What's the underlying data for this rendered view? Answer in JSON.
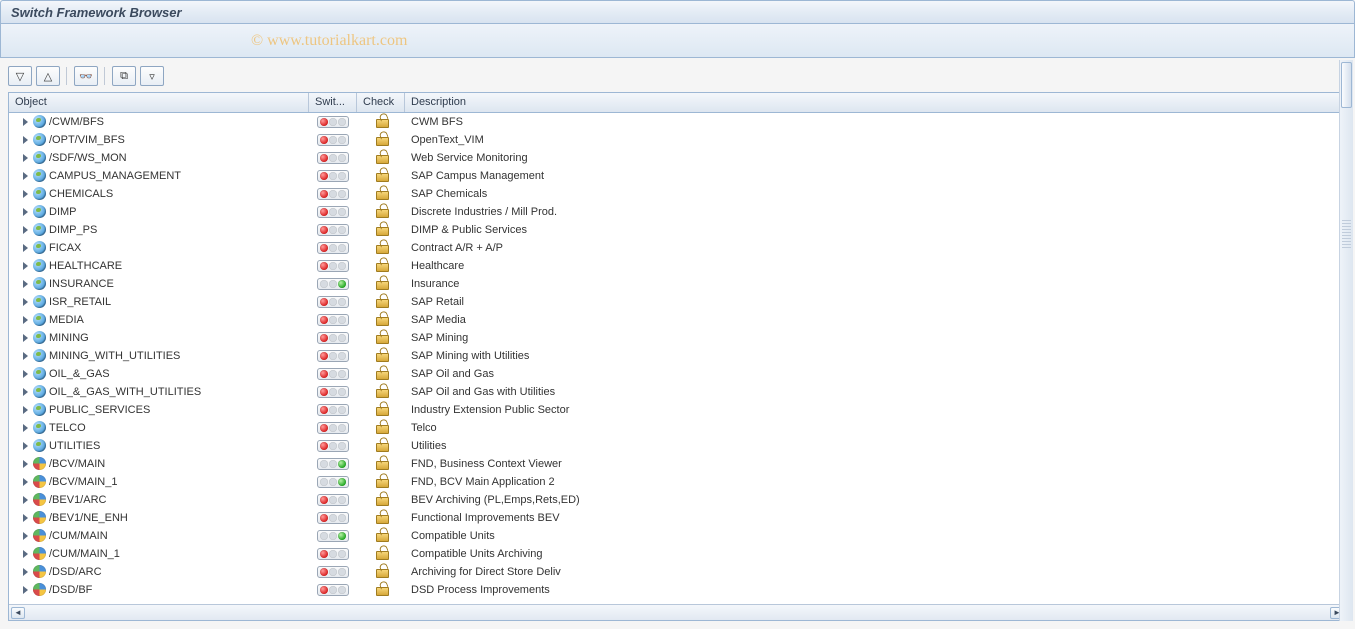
{
  "title": "Switch Framework Browser",
  "watermark": "© www.tutorialkart.com",
  "toolbar": {
    "expand_all": "⬇",
    "collapse_all": "⬆",
    "find": "🔍",
    "layout": "⧉",
    "filter": "▽"
  },
  "columns": {
    "object": "Object",
    "swit": "Swit...",
    "check": "Check",
    "desc": "Description"
  },
  "rows": [
    {
      "icon": "globe",
      "object": "/CWM/BFS",
      "status": "red",
      "desc": "CWM BFS"
    },
    {
      "icon": "globe",
      "object": "/OPT/VIM_BFS",
      "status": "red",
      "desc": "OpenText_VIM"
    },
    {
      "icon": "globe",
      "object": "/SDF/WS_MON",
      "status": "red",
      "desc": "Web Service Monitoring"
    },
    {
      "icon": "globe",
      "object": "CAMPUS_MANAGEMENT",
      "status": "red",
      "desc": "SAP Campus Management"
    },
    {
      "icon": "globe",
      "object": "CHEMICALS",
      "status": "red",
      "desc": "SAP Chemicals"
    },
    {
      "icon": "globe",
      "object": "DIMP",
      "status": "red",
      "desc": "Discrete Industries / Mill Prod."
    },
    {
      "icon": "globe",
      "object": "DIMP_PS",
      "status": "red",
      "desc": "DIMP & Public Services"
    },
    {
      "icon": "globe",
      "object": "FICAX",
      "status": "red",
      "desc": "Contract A/R + A/P"
    },
    {
      "icon": "globe",
      "object": "HEALTHCARE",
      "status": "red",
      "desc": "Healthcare"
    },
    {
      "icon": "globe",
      "object": "INSURANCE",
      "status": "green",
      "desc": "Insurance"
    },
    {
      "icon": "globe",
      "object": "ISR_RETAIL",
      "status": "red",
      "desc": "SAP Retail"
    },
    {
      "icon": "globe",
      "object": "MEDIA",
      "status": "red",
      "desc": "SAP Media"
    },
    {
      "icon": "globe",
      "object": "MINING",
      "status": "red",
      "desc": "SAP Mining"
    },
    {
      "icon": "globe",
      "object": "MINING_WITH_UTILITIES",
      "status": "red",
      "desc": "SAP Mining with Utilities"
    },
    {
      "icon": "globe",
      "object": "OIL_&_GAS",
      "status": "red",
      "desc": "SAP Oil and Gas"
    },
    {
      "icon": "globe",
      "object": "OIL_&_GAS_WITH_UTILITIES",
      "status": "red",
      "desc": "SAP Oil and Gas with Utilities"
    },
    {
      "icon": "globe",
      "object": "PUBLIC_SERVICES",
      "status": "red",
      "desc": "Industry Extension Public Sector"
    },
    {
      "icon": "globe",
      "object": "TELCO",
      "status": "red",
      "desc": "Telco"
    },
    {
      "icon": "globe",
      "object": "UTILITIES",
      "status": "red",
      "desc": "Utilities"
    },
    {
      "icon": "pie",
      "object": "/BCV/MAIN",
      "status": "green",
      "desc": "FND, Business Context Viewer"
    },
    {
      "icon": "pie",
      "object": "/BCV/MAIN_1",
      "status": "green",
      "desc": "FND, BCV Main Application 2"
    },
    {
      "icon": "pie",
      "object": "/BEV1/ARC",
      "status": "red",
      "desc": "BEV Archiving (PL,Emps,Rets,ED)"
    },
    {
      "icon": "pie",
      "object": "/BEV1/NE_ENH",
      "status": "red",
      "desc": "Functional Improvements BEV"
    },
    {
      "icon": "pie",
      "object": "/CUM/MAIN",
      "status": "green",
      "desc": "Compatible Units"
    },
    {
      "icon": "pie",
      "object": "/CUM/MAIN_1",
      "status": "red",
      "desc": "Compatible Units Archiving"
    },
    {
      "icon": "pie",
      "object": "/DSD/ARC",
      "status": "red",
      "desc": "Archiving for Direct Store Deliv"
    },
    {
      "icon": "pie",
      "object": "/DSD/BF",
      "status": "red",
      "desc": "DSD Process Improvements"
    }
  ]
}
